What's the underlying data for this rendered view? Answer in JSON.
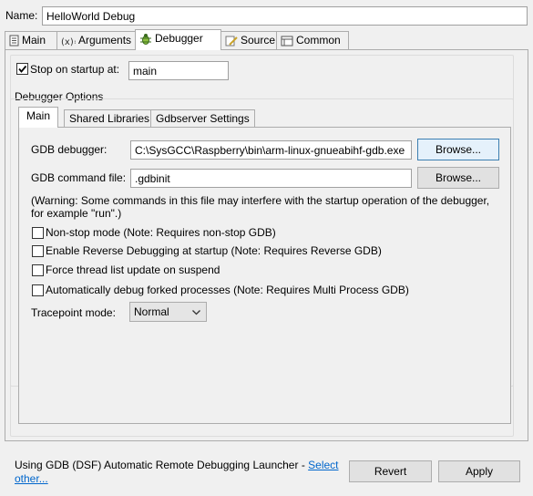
{
  "name_label": "Name:",
  "name_value": "HelloWorld Debug",
  "tabs": [
    {
      "label": "Main",
      "icon": "document-icon"
    },
    {
      "label": "Arguments",
      "icon": "variable-icon"
    },
    {
      "label": "Debugger",
      "icon": "bug-icon"
    },
    {
      "label": "Source",
      "icon": "source-icon"
    },
    {
      "label": "Common",
      "icon": "common-icon"
    }
  ],
  "stop_on_startup": {
    "label": "Stop on startup at:",
    "checked": true,
    "value": "main"
  },
  "debugger_options": {
    "title": "Debugger Options",
    "tabs": [
      "Main",
      "Shared Libraries",
      "Gdbserver Settings"
    ],
    "gdb_debugger_label": "GDB debugger:",
    "gdb_debugger_value": "C:\\SysGCC\\Raspberry\\bin\\arm-linux-gnueabihf-gdb.exe",
    "browse_label": "Browse...",
    "gdb_command_file_label": "GDB command file:",
    "gdb_command_file_value": ".gdbinit",
    "warning_line1": "(Warning: Some commands in this file may interfere with the startup operation of the debugger,",
    "warning_line2": "for example \"run\".)",
    "checkboxes": [
      {
        "label": "Non-stop mode (Note: Requires non-stop GDB)",
        "checked": false
      },
      {
        "label": "Enable Reverse Debugging at startup (Note: Requires Reverse GDB)",
        "checked": false
      },
      {
        "label": "Force thread list update on suspend",
        "checked": false
      },
      {
        "label": "Automatically debug forked processes (Note: Requires Multi Process GDB)",
        "checked": false
      }
    ],
    "tracepoint_label": "Tracepoint mode:",
    "tracepoint_value": "Normal"
  },
  "footer": {
    "launcher_text": "Using GDB (DSF) Automatic Remote Debugging Launcher - ",
    "select_link_1": "Select",
    "select_link_2": "other...",
    "revert_label": "Revert",
    "apply_label": "Apply"
  }
}
